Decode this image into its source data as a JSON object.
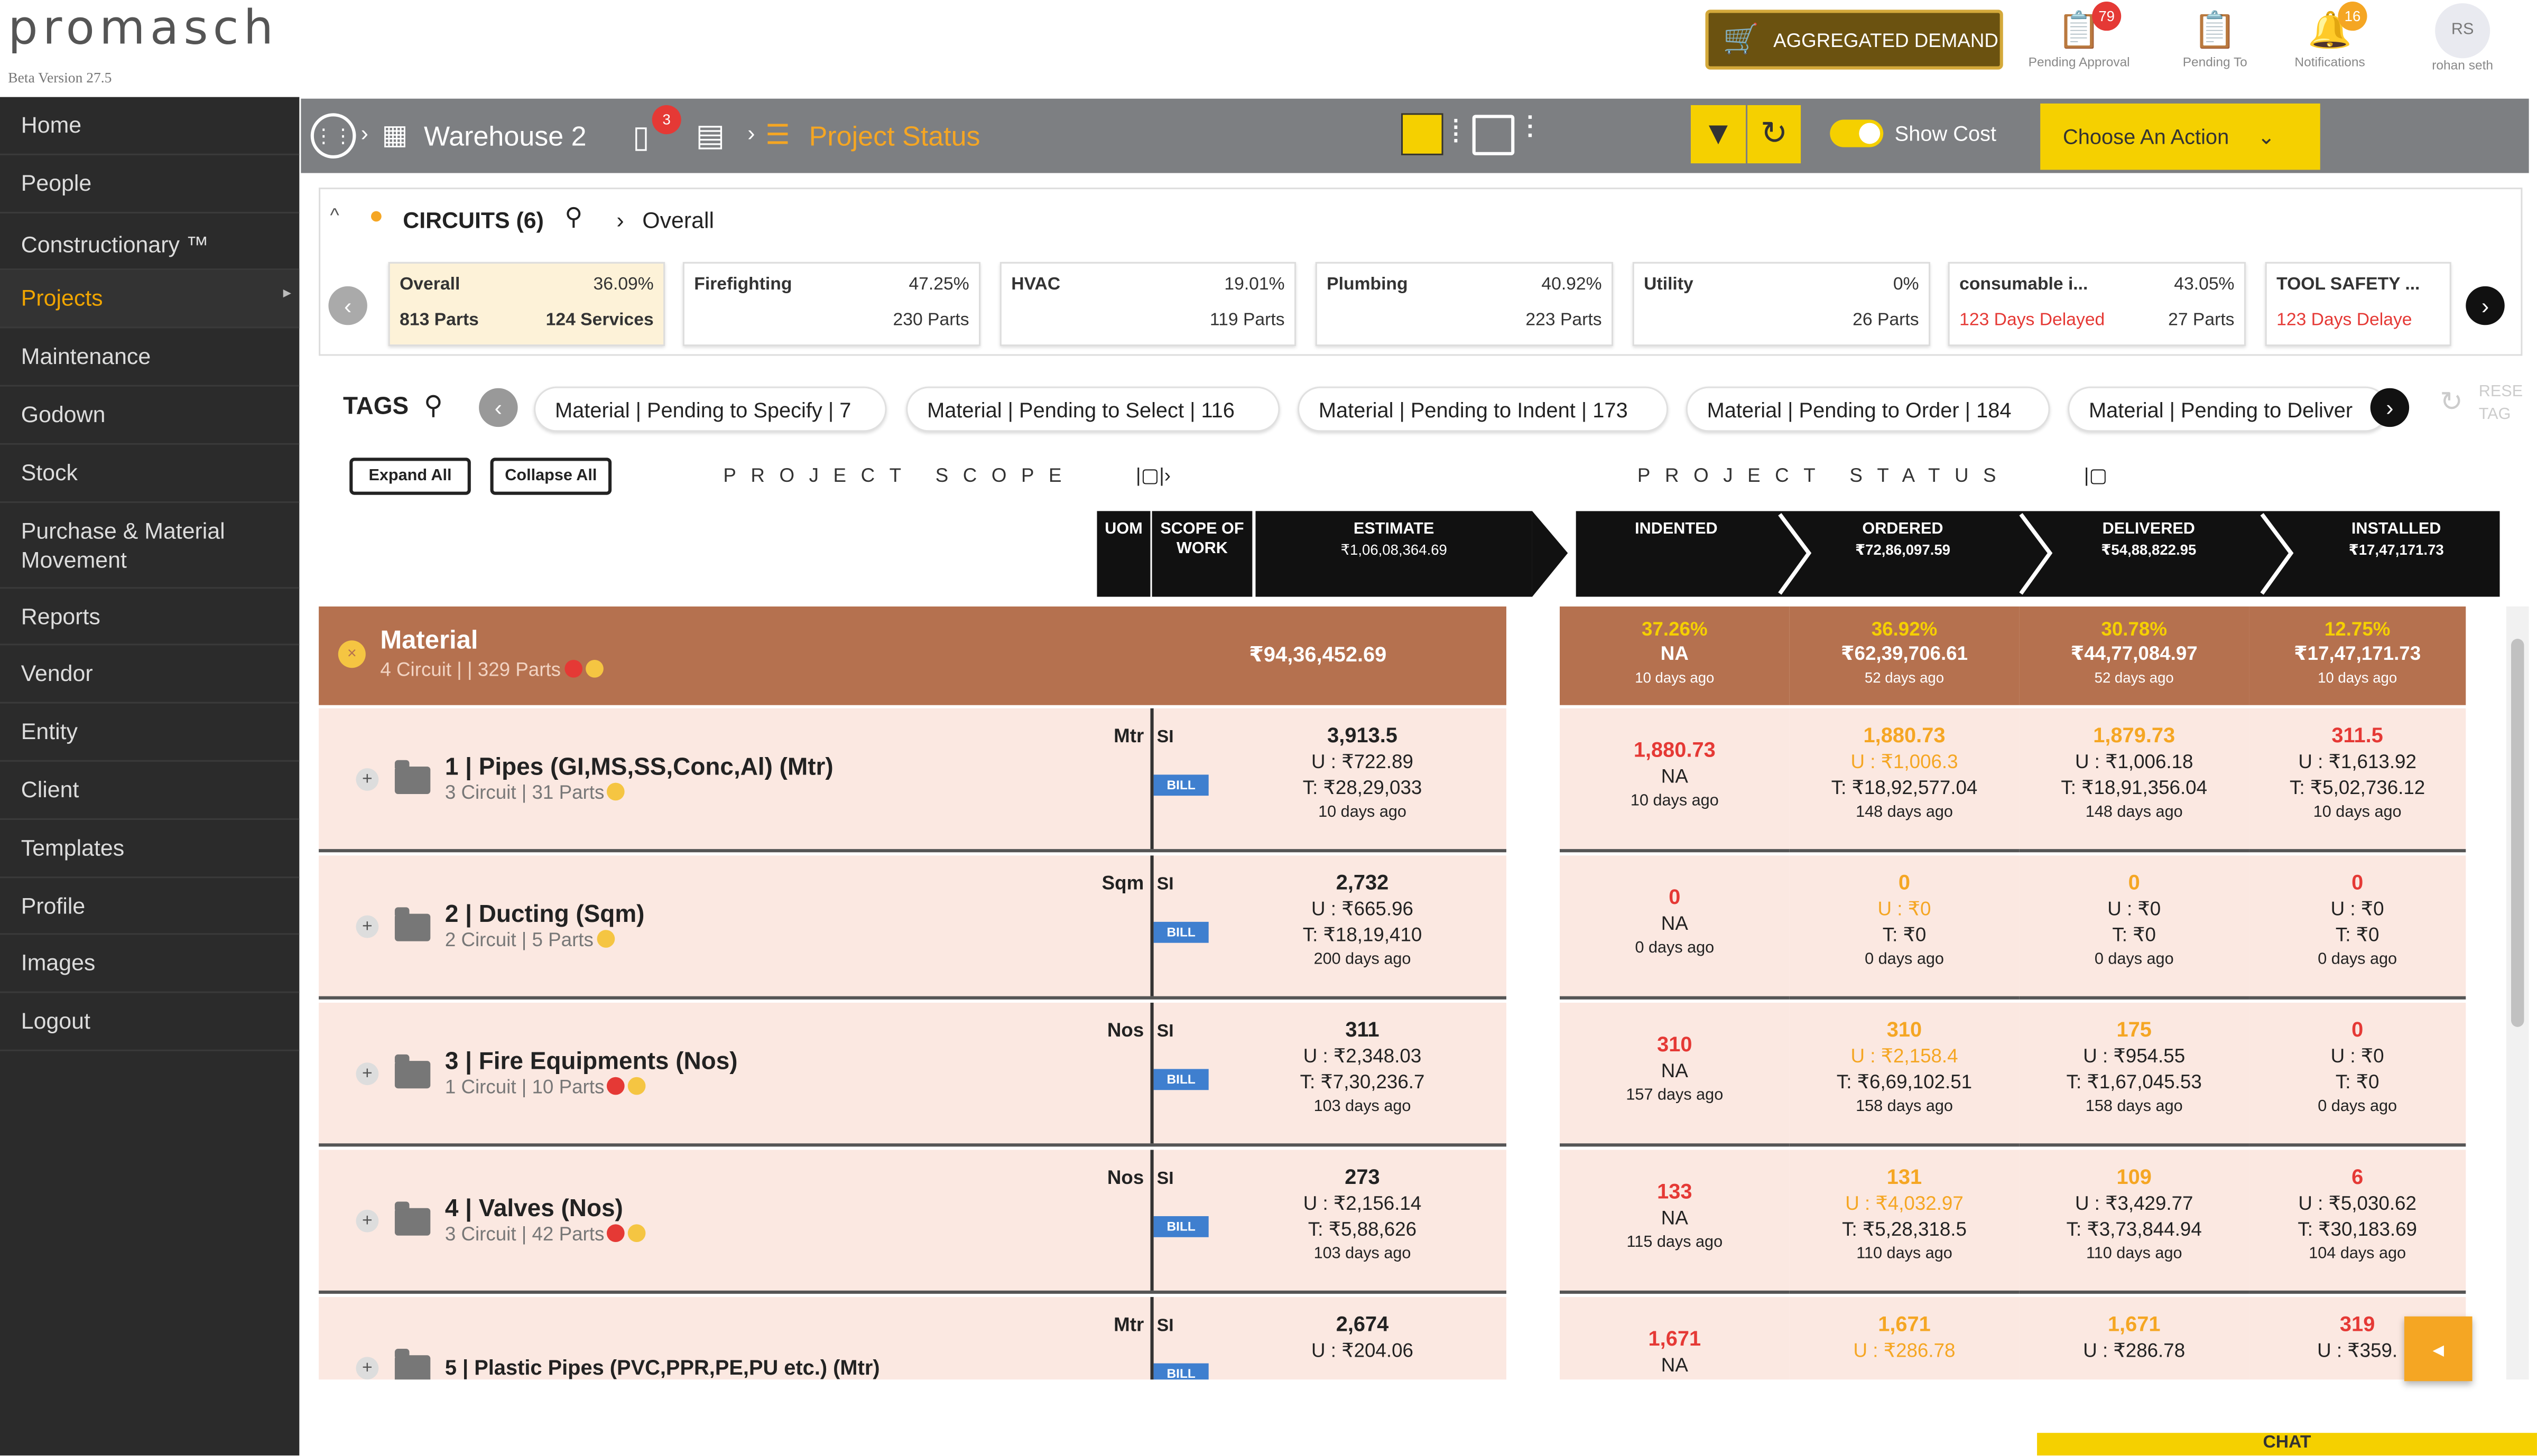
{
  "app": {
    "logo_text": "promasch",
    "version": "Beta Version 27.5"
  },
  "header": {
    "aggregated_demand": "AGGREGATED DEMAND",
    "pending_approval": {
      "label": "Pending Approval",
      "count": "79"
    },
    "pending_to": {
      "label": "Pending To"
    },
    "notifications": {
      "label": "Notifications",
      "count": "16"
    },
    "user": {
      "initials": "RS",
      "name": "rohan seth"
    }
  },
  "sidebar": {
    "items": [
      {
        "label": "Home"
      },
      {
        "label": "People"
      },
      {
        "label": "Constructionary ™"
      },
      {
        "label": "Projects",
        "active": true
      },
      {
        "label": "Maintenance"
      },
      {
        "label": "Godown"
      },
      {
        "label": "Stock"
      },
      {
        "label": "Purchase & Material Movement"
      },
      {
        "label": "Reports"
      },
      {
        "label": "Vendor"
      },
      {
        "label": "Entity"
      },
      {
        "label": "Client"
      },
      {
        "label": "Templates"
      },
      {
        "label": "Profile"
      },
      {
        "label": "Images"
      },
      {
        "label": "Logout"
      }
    ]
  },
  "toolbar": {
    "location": "Warehouse 2",
    "badge": "3",
    "title": "Project Status",
    "show_cost": "Show Cost",
    "choose_action": "Choose An Action"
  },
  "circuits": {
    "header": "CIRCUITS (6)",
    "breadcrumb": "Overall",
    "cards": [
      {
        "name": "Overall",
        "pct": "36.09%",
        "a": "813 Parts",
        "b": "124 Services"
      },
      {
        "name": "Firefighting",
        "pct": "47.25%",
        "a": "",
        "b": "230 Parts"
      },
      {
        "name": "HVAC",
        "pct": "19.01%",
        "a": "",
        "b": "119 Parts"
      },
      {
        "name": "Plumbing",
        "pct": "40.92%",
        "a": "",
        "b": "223 Parts"
      },
      {
        "name": "Utility",
        "pct": "0%",
        "a": "",
        "b": "26 Parts"
      },
      {
        "name": "consumable i...",
        "pct": "43.05%",
        "a": "123 Days Delayed",
        "b": "27 Parts"
      },
      {
        "name": "TOOL SAFETY ...",
        "pct": "",
        "a": "123 Days Delaye",
        "b": ""
      }
    ]
  },
  "tags": {
    "label": "TAGS",
    "items": [
      "Material | Pending to Specify | 7",
      "Material | Pending to Select | 116",
      "Material | Pending to Indent | 173",
      "Material | Pending to Order | 184",
      "Material | Pending to Deliver"
    ],
    "reset": "RESE TAG"
  },
  "controls": {
    "expand": "Expand All",
    "collapse": "Collapse All",
    "scope_label": "PROJECT SCOPE",
    "status_label": "PROJECT STATUS"
  },
  "columns": {
    "uom": "UOM",
    "scope": "SCOPE OF WORK",
    "estimate": {
      "label": "ESTIMATE",
      "value": "₹1,06,08,364.69"
    },
    "indented": {
      "label": "INDENTED",
      "value": ""
    },
    "ordered": {
      "label": "ORDERED",
      "value": "₹72,86,097.59"
    },
    "delivered": {
      "label": "DELIVERED",
      "value": "₹54,88,822.95"
    },
    "installed": {
      "label": "INSTALLED",
      "value": "₹17,47,171.73"
    }
  },
  "material": {
    "title": "Material",
    "sub": "4 Circuit |  | 329 Parts",
    "estimate": "₹94,36,452.69",
    "stats": [
      {
        "pct": "37.26%",
        "val": "NA",
        "days": "10 days ago"
      },
      {
        "pct": "36.92%",
        "val": "₹62,39,706.61",
        "days": "52 days ago"
      },
      {
        "pct": "30.78%",
        "val": "₹44,77,084.97",
        "days": "52 days ago"
      },
      {
        "pct": "12.75%",
        "val": "₹17,47,171.73",
        "days": "10 days ago"
      }
    ]
  },
  "rows": [
    {
      "title": "1 | Pipes (GI,MS,SS,Conc,Al) (Mtr)",
      "sub": "3 Circuit | 31 Parts",
      "uom": "Mtr",
      "scope": "SI",
      "bill": "BILL",
      "est": {
        "q": "3,913.5",
        "u": "U : ₹722.89",
        "t": "T: ₹28,29,033",
        "d": "10 days ago"
      },
      "ind": {
        "q": "1,880.73",
        "u": "NA",
        "t": "",
        "d": "10 days ago"
      },
      "ord": {
        "q": "1,880.73",
        "u": "U : ₹1,006.3",
        "t": "T: ₹18,92,577.04",
        "d": "148 days ago"
      },
      "del": {
        "q": "1,879.73",
        "u": "U : ₹1,006.18",
        "t": "T: ₹18,91,356.04",
        "d": "148 days ago"
      },
      "ins": {
        "q": "311.5",
        "u": "U : ₹1,613.92",
        "t": "T: ₹5,02,736.12",
        "d": "10 days ago"
      }
    },
    {
      "title": "2 | Ducting (Sqm)",
      "sub": "2 Circuit | 5 Parts",
      "uom": "Sqm",
      "scope": "SI",
      "bill": "BILL",
      "est": {
        "q": "2,732",
        "u": "U : ₹665.96",
        "t": "T: ₹18,19,410",
        "d": "200 days ago"
      },
      "ind": {
        "q": "0",
        "u": "NA",
        "t": "",
        "d": "0 days ago"
      },
      "ord": {
        "q": "0",
        "u": "U : ₹0",
        "t": "T: ₹0",
        "d": "0 days ago"
      },
      "del": {
        "q": "0",
        "u": "U : ₹0",
        "t": "T: ₹0",
        "d": "0 days ago"
      },
      "ins": {
        "q": "0",
        "u": "U : ₹0",
        "t": "T: ₹0",
        "d": "0 days ago"
      }
    },
    {
      "title": "3 | Fire Equipments (Nos)",
      "sub": "1 Circuit | 10 Parts",
      "uom": "Nos",
      "scope": "SI",
      "bill": "BILL",
      "est": {
        "q": "311",
        "u": "U : ₹2,348.03",
        "t": "T: ₹7,30,236.7",
        "d": "103 days ago"
      },
      "ind": {
        "q": "310",
        "u": "NA",
        "t": "",
        "d": "157 days ago"
      },
      "ord": {
        "q": "310",
        "u": "U : ₹2,158.4",
        "t": "T: ₹6,69,102.51",
        "d": "158 days ago"
      },
      "del": {
        "q": "175",
        "u": "U : ₹954.55",
        "t": "T: ₹1,67,045.53",
        "d": "158 days ago"
      },
      "ins": {
        "q": "0",
        "u": "U : ₹0",
        "t": "T: ₹0",
        "d": "0 days ago"
      }
    },
    {
      "title": "4 | Valves (Nos)",
      "sub": "3 Circuit | 42 Parts",
      "uom": "Nos",
      "scope": "SI",
      "bill": "BILL",
      "est": {
        "q": "273",
        "u": "U : ₹2,156.14",
        "t": "T: ₹5,88,626",
        "d": "103 days ago"
      },
      "ind": {
        "q": "133",
        "u": "NA",
        "t": "",
        "d": "115 days ago"
      },
      "ord": {
        "q": "131",
        "u": "U : ₹4,032.97",
        "t": "T: ₹5,28,318.5",
        "d": "110 days ago"
      },
      "del": {
        "q": "109",
        "u": "U : ₹3,429.77",
        "t": "T: ₹3,73,844.94",
        "d": "110 days ago"
      },
      "ins": {
        "q": "6",
        "u": "U : ₹5,030.62",
        "t": "T: ₹30,183.69",
        "d": "104 days ago"
      }
    },
    {
      "title": "5 | Plastic Pipes (PVC,PPR,PE,PU etc.) (Mtr)",
      "sub": "",
      "uom": "Mtr",
      "scope": "SI",
      "bill": "BILL",
      "est": {
        "q": "2,674",
        "u": "U : ₹204.06",
        "t": "",
        "d": ""
      },
      "ind": {
        "q": "1,671",
        "u": "NA",
        "t": "",
        "d": ""
      },
      "ord": {
        "q": "1,671",
        "u": "U : ₹286.78",
        "t": "",
        "d": ""
      },
      "del": {
        "q": "1,671",
        "u": "U : ₹286.78",
        "t": "",
        "d": ""
      },
      "ins": {
        "q": "319",
        "u": "U : ₹359.",
        "t": "",
        "d": ""
      }
    }
  ],
  "chat": "CHAT"
}
